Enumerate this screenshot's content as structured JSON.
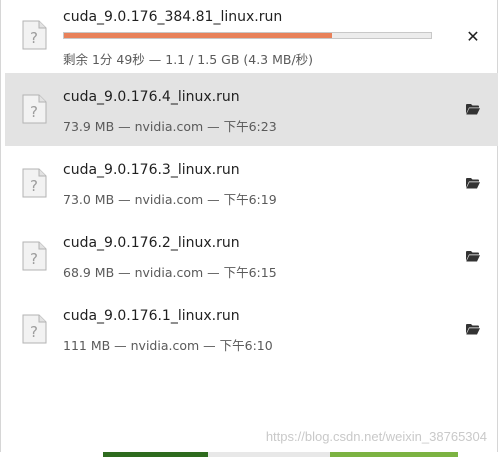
{
  "downloads": [
    {
      "name": "cuda_9.0.176_384.81_linux.run",
      "status": "剩余 1分 49秒 — 1.1 / 1.5 GB (4.3 MB/秒)",
      "progress_fraction": 0.73,
      "in_progress": true,
      "action_icon": "cancel-icon"
    },
    {
      "name": "cuda_9.0.176.4_linux.run",
      "status": "73.9 MB — nvidia.com — 下午6:23",
      "selected": true,
      "action_icon": "folder-icon"
    },
    {
      "name": "cuda_9.0.176.3_linux.run",
      "status": "73.0 MB — nvidia.com — 下午6:19",
      "action_icon": "folder-icon"
    },
    {
      "name": "cuda_9.0.176.2_linux.run",
      "status": "68.9 MB — nvidia.com — 下午6:15",
      "action_icon": "folder-icon"
    },
    {
      "name": "cuda_9.0.176.1_linux.run",
      "status": "111 MB — nvidia.com — 下午6:10",
      "action_icon": "folder-icon"
    }
  ],
  "watermark": "https://blog.csdn.net/weixin_38765304",
  "colors": {
    "progress_fill": "#e8815a",
    "selected_row": "#e3e3e3",
    "bottom_strip": [
      "#ffffff",
      "#2e6b1e",
      "#e8e8e8",
      "#7cb342",
      "#ffffff"
    ]
  }
}
